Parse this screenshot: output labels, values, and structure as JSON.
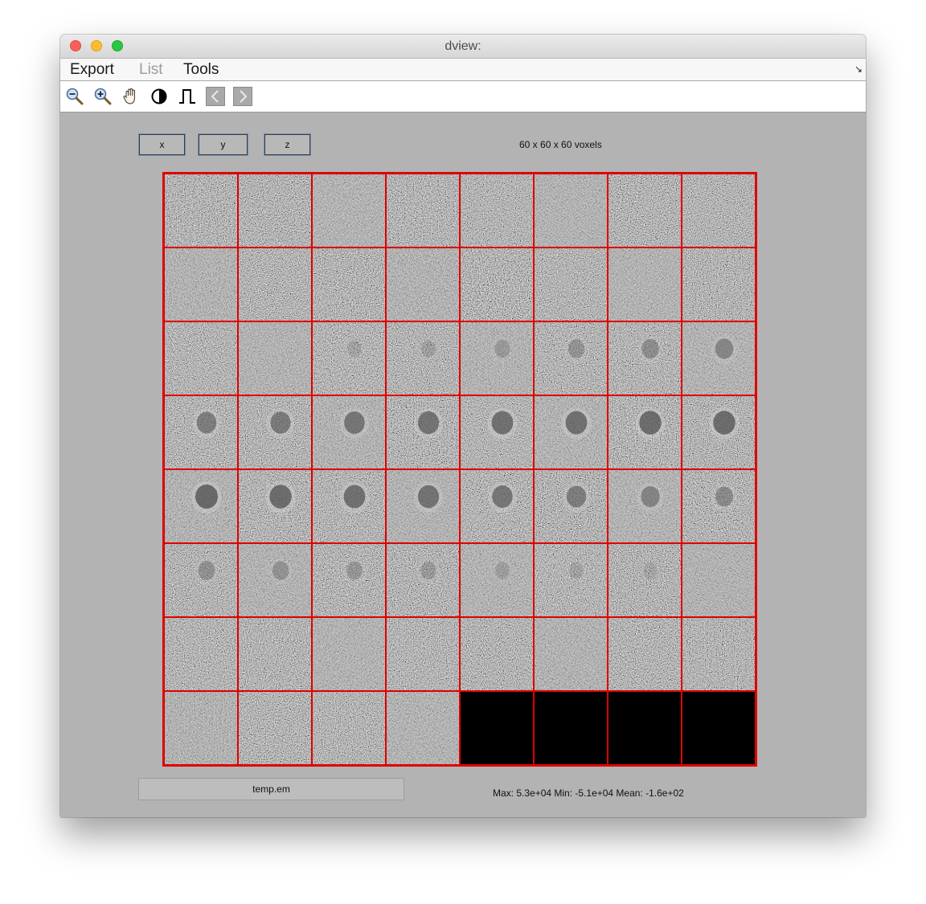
{
  "window": {
    "title": "dview:"
  },
  "menu": {
    "items": [
      {
        "label": "Export",
        "enabled": true
      },
      {
        "label": "List",
        "enabled": false
      },
      {
        "label": "Tools",
        "enabled": true
      }
    ]
  },
  "toolbar": {
    "tools": [
      "zoom-out-icon",
      "zoom-in-icon",
      "pan-hand-icon",
      "contrast-icon",
      "threshold-icon",
      "previous-icon",
      "next-icon"
    ]
  },
  "axes": {
    "x_label": "x",
    "y_label": "y",
    "z_label": "z"
  },
  "volume": {
    "dimensions": "60 x 60 x 60 voxels",
    "grid_columns": 8,
    "grid_rows": 8,
    "slices_shown": 60,
    "slice_border_color": "#e00000",
    "slice_blob_intensity": [
      0,
      0,
      0,
      0,
      0,
      0,
      0,
      0,
      0,
      0,
      0,
      0,
      0,
      0,
      0,
      0,
      0,
      0,
      0.1,
      0.15,
      0.25,
      0.35,
      0.45,
      0.55,
      0.7,
      0.75,
      0.8,
      0.85,
      0.9,
      0.9,
      0.95,
      0.95,
      1.0,
      0.95,
      0.9,
      0.85,
      0.8,
      0.7,
      0.6,
      0.5,
      0.4,
      0.35,
      0.3,
      0.25,
      0.15,
      0.1,
      0.05,
      0,
      0,
      0,
      0,
      0,
      0,
      0,
      0,
      0,
      0,
      0,
      0,
      0
    ]
  },
  "footer": {
    "filename": "temp.em",
    "stats": "Max: 5.3e+04 Min: -5.1e+04 Mean: -1.6e+02"
  }
}
